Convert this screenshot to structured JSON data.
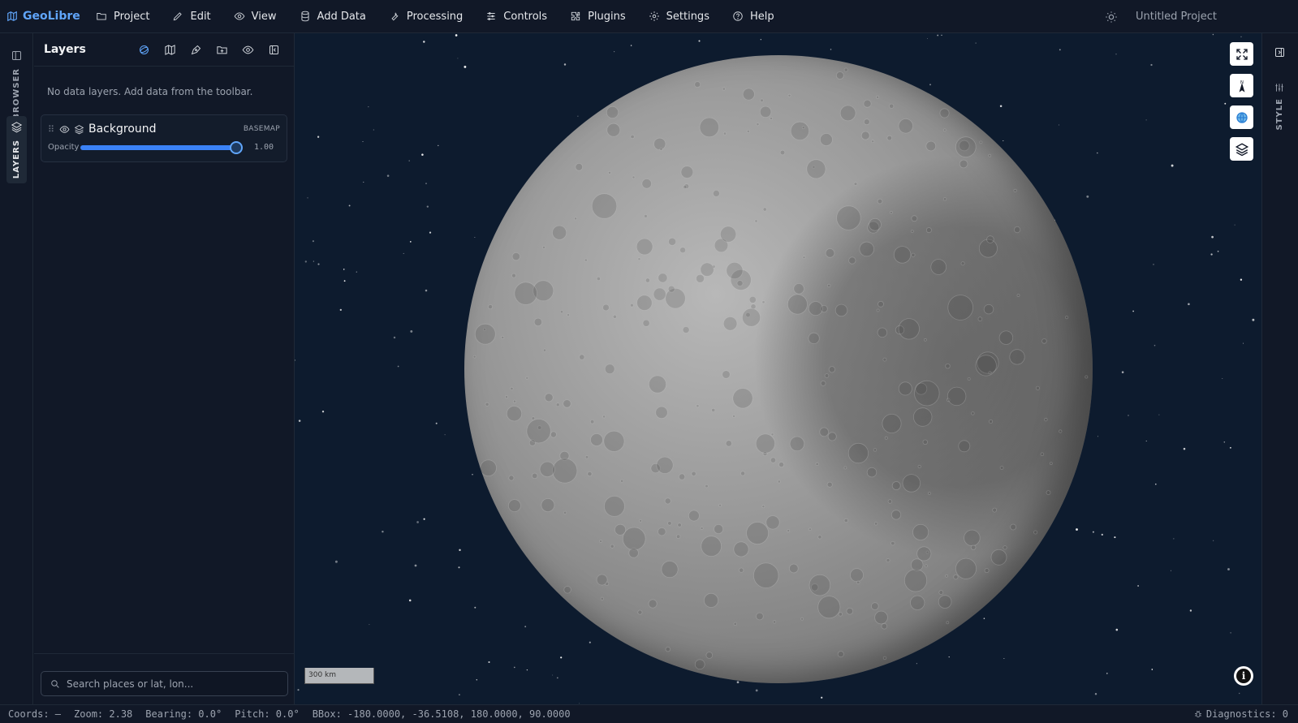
{
  "app": {
    "name": "GeoLibre",
    "project_title": "Untitled Project"
  },
  "menu": [
    {
      "label": "Project",
      "icon": "folder-icon"
    },
    {
      "label": "Edit",
      "icon": "pencil-icon"
    },
    {
      "label": "View",
      "icon": "eye-icon"
    },
    {
      "label": "Add Data",
      "icon": "database-icon"
    },
    {
      "label": "Processing",
      "icon": "wrench-icon"
    },
    {
      "label": "Controls",
      "icon": "sliders-icon"
    },
    {
      "label": "Plugins",
      "icon": "puzzle-icon"
    },
    {
      "label": "Settings",
      "icon": "gear-icon"
    },
    {
      "label": "Help",
      "icon": "help-circle-icon"
    }
  ],
  "left_rail": {
    "browser_label": "BROWSER",
    "layers_label": "LAYERS"
  },
  "layers_panel": {
    "title": "Layers",
    "empty_message": "No data layers. Add data from the toolbar.",
    "tools": [
      "globe-projection-icon",
      "map-icon",
      "draw-icon",
      "add-folder-icon",
      "visibility-icon",
      "collapse-panel-icon"
    ],
    "background_layer": {
      "name": "Background",
      "badge": "BASEMAP",
      "opacity_label": "Opacity",
      "opacity_value": "1.00",
      "opacity": 1.0
    },
    "search": {
      "placeholder": "Search places or lat, lon...",
      "value": ""
    }
  },
  "map": {
    "scale_label": "300 km",
    "controls": [
      "fullscreen-icon",
      "compass-icon",
      "globe-icon",
      "layers-icon"
    ],
    "background_color": "#0d1b2e"
  },
  "right_rail": {
    "style_label": "STYLE"
  },
  "status": {
    "coords": "Coords: —",
    "zoom": "Zoom: 2.38",
    "bearing": "Bearing: 0.0°",
    "pitch": "Pitch: 0.0°",
    "bbox": "BBox: -180.0000, -36.5108, 180.0000, 90.0000",
    "diagnostics": "Diagnostics: 0"
  },
  "colors": {
    "accent": "#60a5fa",
    "panel_bg": "#111827",
    "slider_fill": "#3b82f6"
  }
}
